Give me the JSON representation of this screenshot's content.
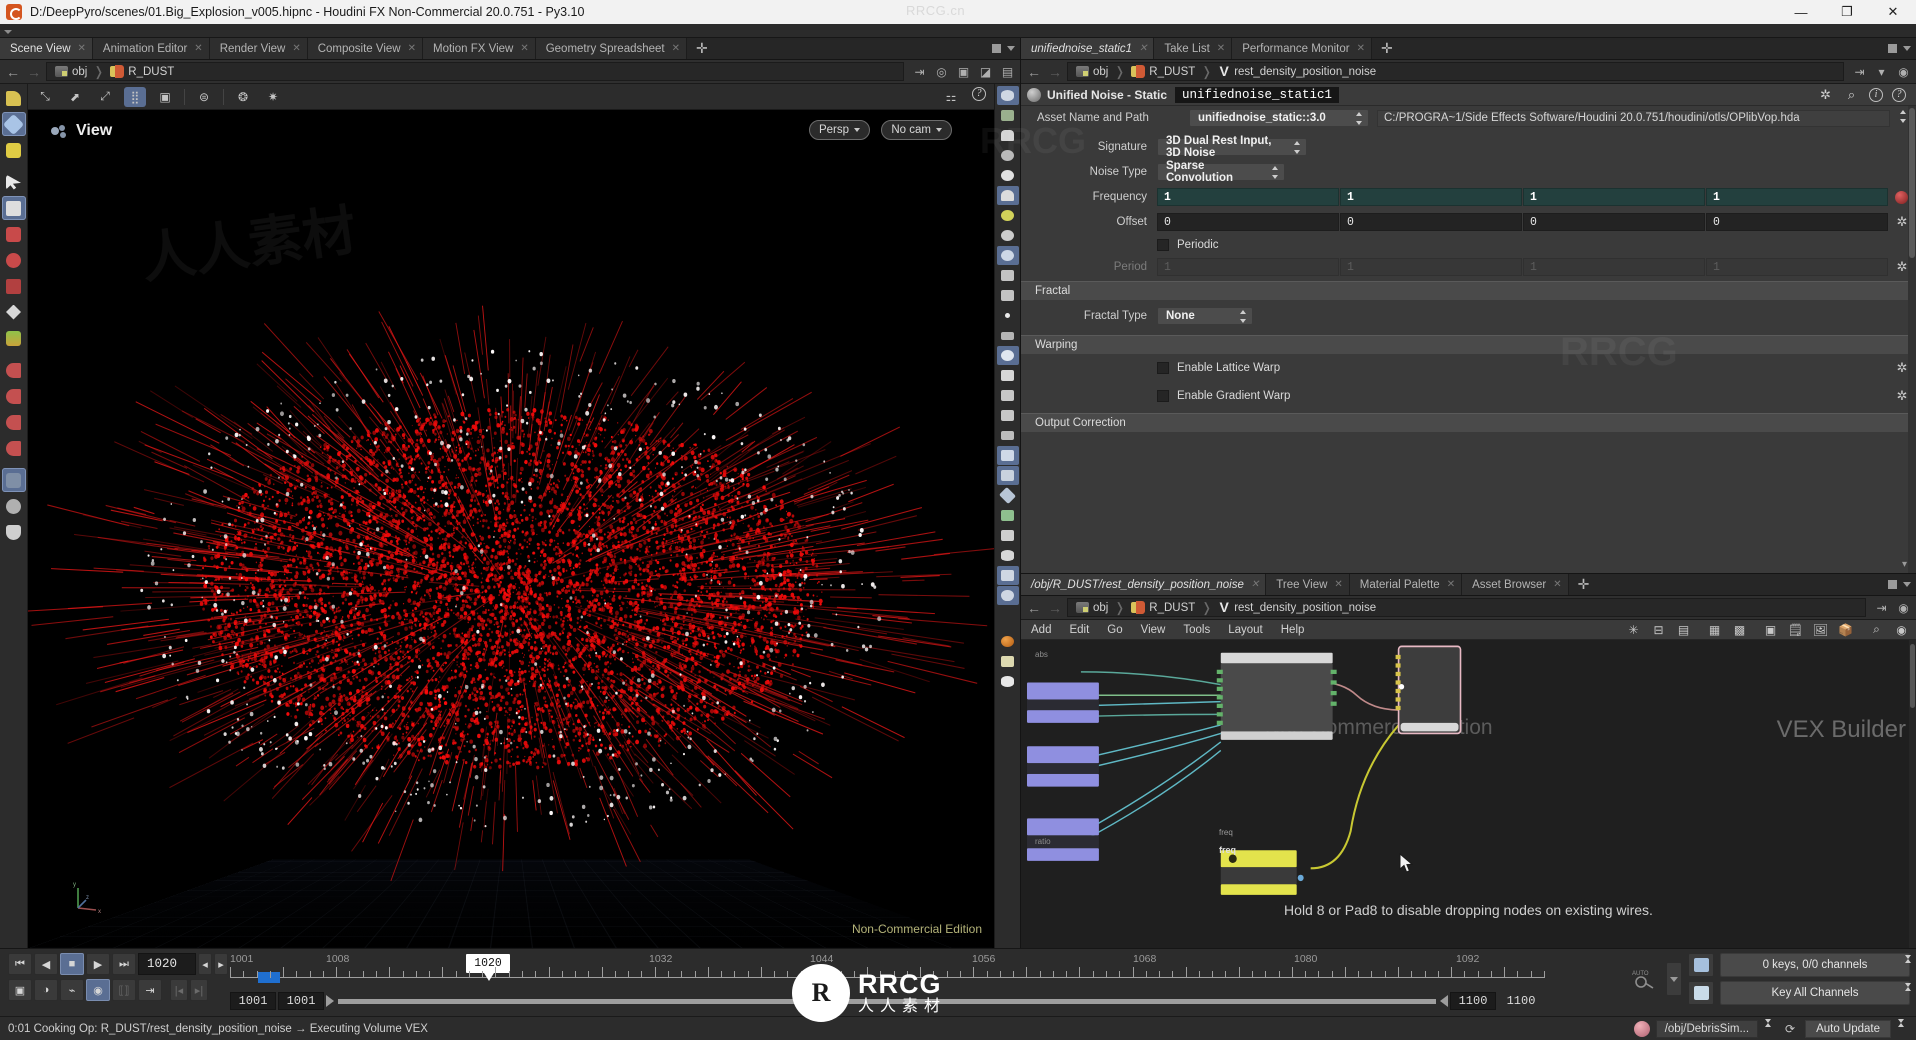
{
  "window": {
    "title": "D:/DeepPyro/scenes/01.Big_Explosion_v005.hipnc - Houdini FX Non-Commercial 20.0.751 - Py3.10",
    "watermark": "RRCG.cn",
    "minimize": "—",
    "maximize": "❐",
    "close": "✕"
  },
  "left_tabs": [
    {
      "label": "Scene View",
      "active": true
    },
    {
      "label": "Animation Editor",
      "active": false
    },
    {
      "label": "Render View",
      "active": false
    },
    {
      "label": "Composite View",
      "active": false
    },
    {
      "label": "Motion FX View",
      "active": false
    },
    {
      "label": "Geometry Spreadsheet",
      "active": false
    }
  ],
  "left_path": {
    "back": "←",
    "forward": "→",
    "crumbs": [
      "obj",
      "R_DUST"
    ]
  },
  "viewport": {
    "view_label": "View",
    "persp": "Persp",
    "camera": "No cam",
    "non_commercial": "Non-Commercial Edition",
    "axis_x": "x",
    "axis_y": "y",
    "axis_z": "z"
  },
  "right_tabs": [
    {
      "label": "unifiednoise_static1",
      "active": true,
      "italic": true
    },
    {
      "label": "Take List",
      "active": false,
      "italic": false
    },
    {
      "label": "Performance Monitor",
      "active": false,
      "italic": false
    }
  ],
  "right_path": {
    "crumbs": [
      "obj",
      "R_DUST",
      "rest_density_position_noise"
    ]
  },
  "params": {
    "node_type": "Unified Noise - Static",
    "node_name": "unifiednoise_static1",
    "asset_label": "Asset Name and Path",
    "asset_name": "unifiednoise_static::3.0",
    "asset_path": "C:/PROGRA~1/Side Effects Software/Houdini 20.0.751/houdini/otls/OPlibVop.hda",
    "signature_label": "Signature",
    "signature_value": "3D Dual Rest Input, 3D Noise",
    "noise_type_label": "Noise Type",
    "noise_type_value": "Sparse Convolution",
    "frequency_label": "Frequency",
    "frequency": [
      "1",
      "1",
      "1",
      "1"
    ],
    "offset_label": "Offset",
    "offset": [
      "0",
      "0",
      "0",
      "0"
    ],
    "periodic_label": "Periodic",
    "periodic_checked": false,
    "period_label": "Period",
    "period": [
      "1",
      "1",
      "1",
      "1"
    ],
    "fractal_section": "Fractal",
    "fractal_type_label": "Fractal Type",
    "fractal_type_value": "None",
    "warping_section": "Warping",
    "lattice_warp_label": "Enable Lattice Warp",
    "gradient_warp_label": "Enable Gradient Warp",
    "output_section": "Output Correction",
    "accent_teal": "#23403e"
  },
  "network_tabs": [
    {
      "label": "/obj/R_DUST/rest_density_position_noise",
      "active": true,
      "italic": true
    },
    {
      "label": "Tree View",
      "active": false,
      "italic": false
    },
    {
      "label": "Material Palette",
      "active": false,
      "italic": false
    },
    {
      "label": "Asset Browser",
      "active": false,
      "italic": false
    }
  ],
  "network_path": {
    "crumbs": [
      "obj",
      "R_DUST",
      "rest_density_position_noise"
    ]
  },
  "network_menu": [
    "Add",
    "Edit",
    "Go",
    "View",
    "Tools",
    "Layout",
    "Help"
  ],
  "network": {
    "hint": "Hold 8 or Pad8 to disable dropping nodes on existing wires.",
    "watermark_left": "Non-Commercial Edition",
    "watermark_right": "VEX Builder",
    "node_labels": [
      "abs",
      "ratio",
      "freq",
      "freq"
    ]
  },
  "playbar": {
    "buttons": [
      "⏮",
      "◀",
      "■",
      "▶",
      "⏭"
    ],
    "current_frame": "1020",
    "playhead_label": "1020",
    "tick_labels": [
      "1001",
      "1008",
      "1032",
      "1044",
      "1056",
      "1068",
      "1080",
      "1092"
    ],
    "range_start": "1001",
    "range_start2": "1001",
    "range_end": "1100",
    "range_end2": "1100",
    "keys_menu": "0 keys, 0/0 channels",
    "key_channels_menu": "Key All Channels",
    "autokey": "AUTO"
  },
  "status": {
    "text": "0:01 Cooking Op:  R_DUST/rest_density_position_noise → Executing Volume VEX",
    "node_path": "/obj/DebrisSim...",
    "update_mode": "Auto Update"
  },
  "center_watermark": {
    "mark": "R",
    "line1": "RRCG",
    "line2": "人人素材"
  }
}
